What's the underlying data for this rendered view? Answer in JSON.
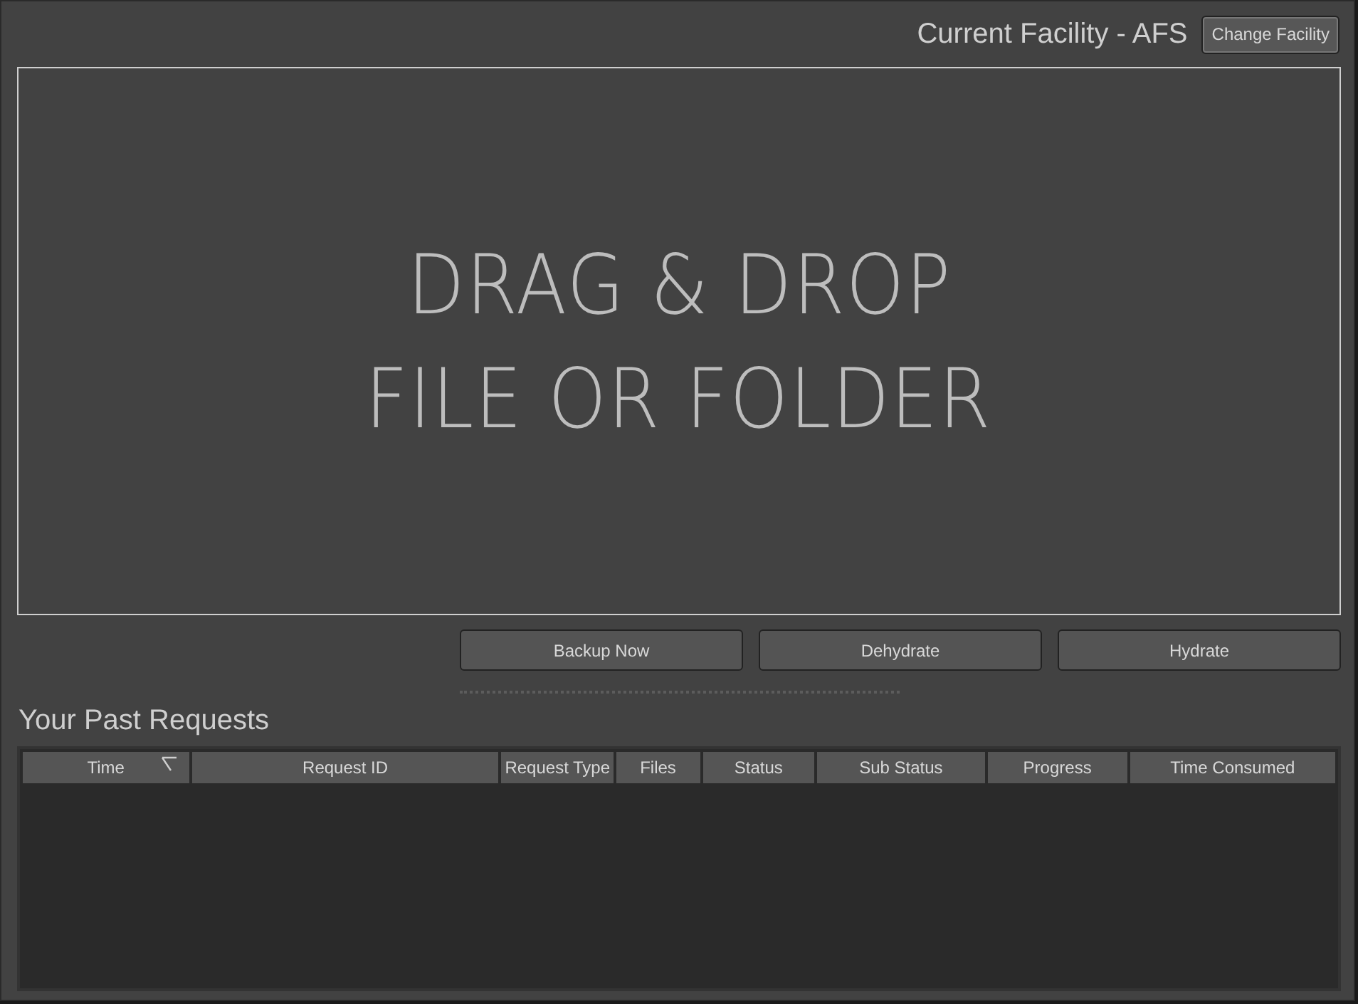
{
  "header": {
    "facility": "Current Facility - AFS",
    "change_button": "Change Facility"
  },
  "drop_zone": {
    "lines": [
      "DRAG & DROP",
      "FILE OR FOLDER"
    ]
  },
  "actions": [
    "Backup Now",
    "Dehydrate",
    "Hydrate"
  ],
  "past_requests": {
    "title": "Your Past Requests",
    "columns": [
      {
        "label": "Time",
        "sorted": true
      },
      {
        "label": "Request ID",
        "sorted": false
      },
      {
        "label": "Request Type",
        "sorted": false
      },
      {
        "label": "Files",
        "sorted": false
      },
      {
        "label": "Status",
        "sorted": false
      },
      {
        "label": "Sub Status",
        "sorted": false
      },
      {
        "label": "Progress",
        "sorted": false
      },
      {
        "label": "Time Consumed",
        "sorted": false
      }
    ]
  }
}
